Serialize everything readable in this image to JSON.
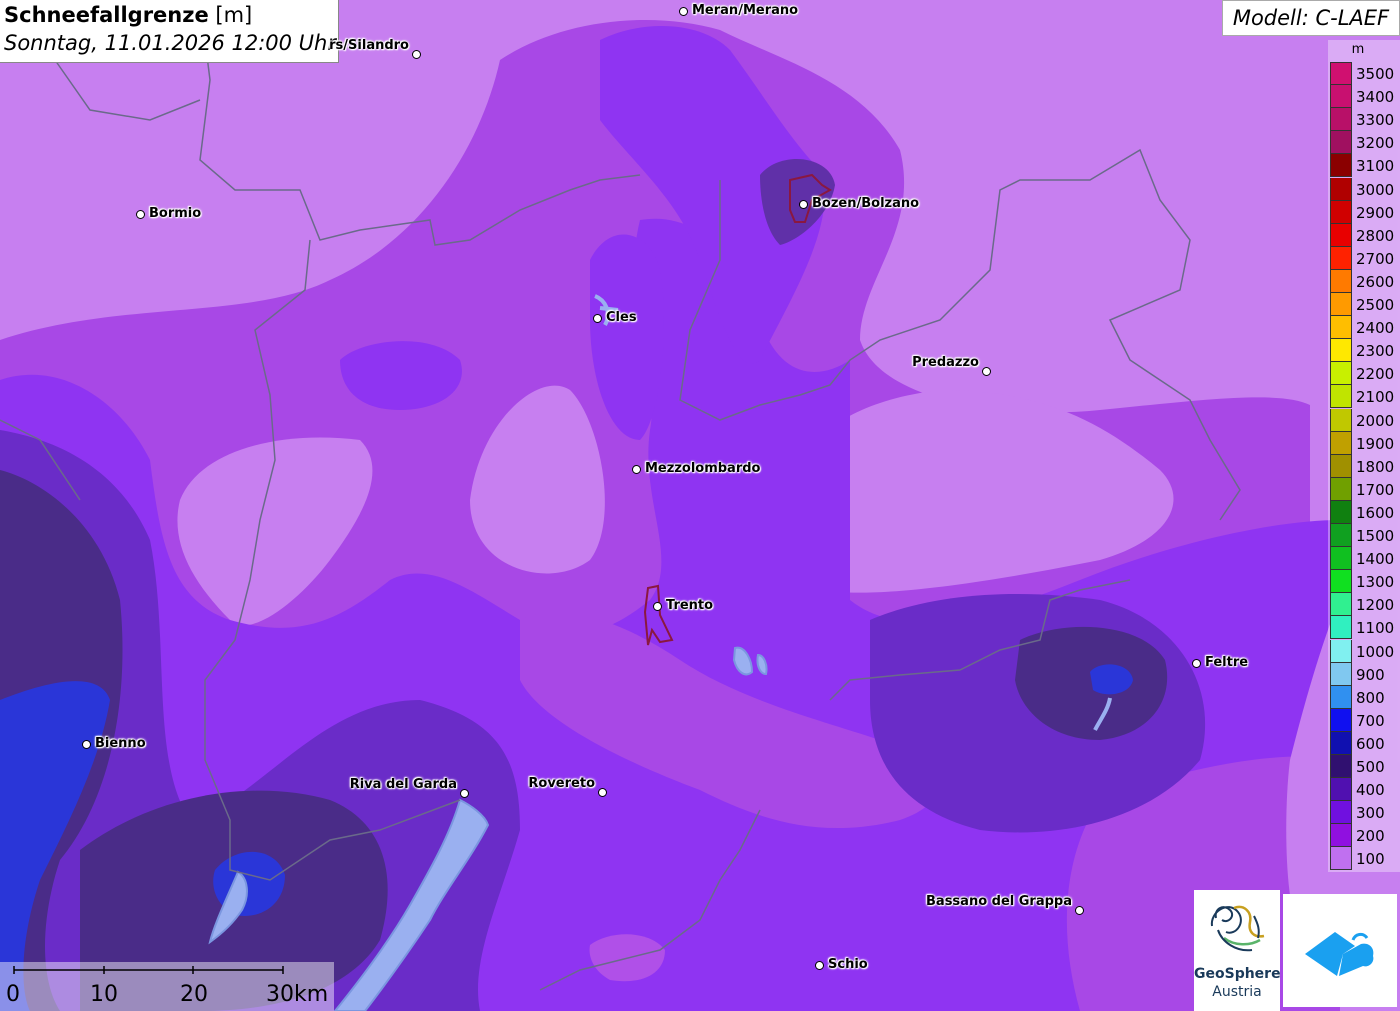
{
  "header": {
    "title_bold": "Schneefallgrenze",
    "title_unit": " [m]",
    "date": "Sonntag, 11.01.2026 12:00 Uhr"
  },
  "model": {
    "label": "Modell: C-LAEF"
  },
  "legend": {
    "unit": "m",
    "items": [
      {
        "label": "3500",
        "color": "#d01070"
      },
      {
        "label": "3400",
        "color": "#c81070"
      },
      {
        "label": "3300",
        "color": "#b81068"
      },
      {
        "label": "3200",
        "color": "#a01060"
      },
      {
        "label": "3100",
        "color": "#8b0000"
      },
      {
        "label": "3000",
        "color": "#b00000"
      },
      {
        "label": "2900",
        "color": "#d00000"
      },
      {
        "label": "2800",
        "color": "#e80000"
      },
      {
        "label": "2700",
        "color": "#ff2200"
      },
      {
        "label": "2600",
        "color": "#ff7a00"
      },
      {
        "label": "2500",
        "color": "#ff9a00"
      },
      {
        "label": "2400",
        "color": "#ffbe00"
      },
      {
        "label": "2300",
        "color": "#ffe800"
      },
      {
        "label": "2200",
        "color": "#c8f000"
      },
      {
        "label": "2100",
        "color": "#c0e400"
      },
      {
        "label": "2000",
        "color": "#c0c800"
      },
      {
        "label": "1900",
        "color": "#c0a000"
      },
      {
        "label": "1800",
        "color": "#a09000"
      },
      {
        "label": "1700",
        "color": "#70a000"
      },
      {
        "label": "1600",
        "color": "#108010"
      },
      {
        "label": "1500",
        "color": "#10a020"
      },
      {
        "label": "1400",
        "color": "#10c020"
      },
      {
        "label": "1300",
        "color": "#10e020"
      },
      {
        "label": "1200",
        "color": "#30f090"
      },
      {
        "label": "1100",
        "color": "#30f0c0"
      },
      {
        "label": "1000",
        "color": "#80f0f0"
      },
      {
        "label": "900",
        "color": "#80c8f0"
      },
      {
        "label": "800",
        "color": "#3090f0"
      },
      {
        "label": "700",
        "color": "#1010f0"
      },
      {
        "label": "600",
        "color": "#1010b0"
      },
      {
        "label": "500",
        "color": "#301070"
      },
      {
        "label": "400",
        "color": "#5010b0"
      },
      {
        "label": "300",
        "color": "#7010e0"
      },
      {
        "label": "200",
        "color": "#9010e0"
      },
      {
        "label": "100",
        "color": "#c070f0"
      }
    ]
  },
  "cities": [
    {
      "name": "Meran/Merano",
      "labelPos": "right"
    },
    {
      "name": "rs/Silandro",
      "labelPos": "left"
    },
    {
      "name": "Bormio",
      "labelPos": "right"
    },
    {
      "name": "Bozen/Bolzano",
      "labelPos": "right"
    },
    {
      "name": "Cles",
      "labelPos": "right"
    },
    {
      "name": "Predazzo",
      "labelPos": "left"
    },
    {
      "name": "Mezzolombardo",
      "labelPos": "right"
    },
    {
      "name": "Trento",
      "labelPos": "right"
    },
    {
      "name": "Feltre",
      "labelPos": "right"
    },
    {
      "name": "Bienno",
      "labelPos": "right"
    },
    {
      "name": "Riva del Garda",
      "labelPos": "left"
    },
    {
      "name": "Rovereto",
      "labelPos": "left"
    },
    {
      "name": "Bassano del Grappa",
      "labelPos": "left"
    },
    {
      "name": "Schio",
      "labelPos": "right"
    }
  ],
  "scale": {
    "labels": [
      "0",
      "10",
      "20",
      "30km"
    ]
  },
  "logos": {
    "geosphere_line1": "GeoSphere",
    "geosphere_line2": "Austria"
  },
  "colors": {
    "band100": "#c77ff0",
    "band200": "#a840e8",
    "band300": "#8a30f0",
    "band400": "#6c2ad0",
    "band500": "#4a2a88",
    "band700": "#3030e0"
  }
}
